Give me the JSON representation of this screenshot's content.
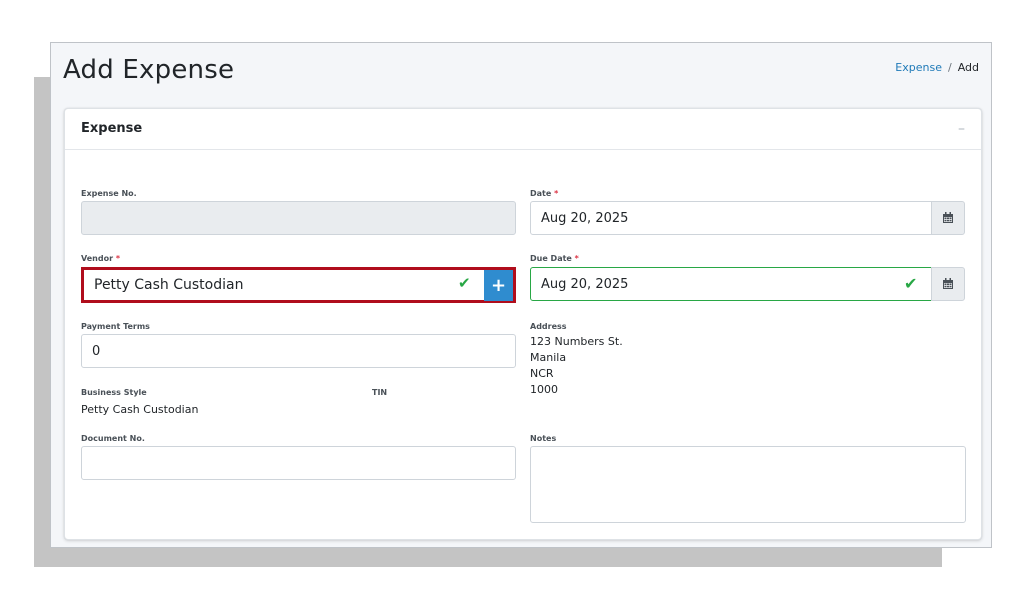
{
  "page": {
    "title": "Add Expense"
  },
  "breadcrumb": {
    "link": "Expense",
    "separator": "/",
    "current": "Add"
  },
  "card": {
    "title": "Expense",
    "collapse_icon": "minus-icon",
    "collapse_label": "–"
  },
  "form": {
    "expense_no": {
      "label": "Expense No.",
      "value": ""
    },
    "date": {
      "label": "Date",
      "required": "*",
      "value": "Aug 20, 2025",
      "icon": "calendar-icon"
    },
    "vendor": {
      "label": "Vendor",
      "required": "*",
      "value": "Petty Cash Custodian",
      "valid_icon": "check-icon",
      "add_label": "+"
    },
    "due_date": {
      "label": "Due Date",
      "required": "*",
      "value": "Aug 20, 2025",
      "valid_icon": "check-icon",
      "icon": "calendar-icon"
    },
    "payment_terms": {
      "label": "Payment Terms",
      "value": "0"
    },
    "address": {
      "label": "Address",
      "lines": [
        "123 Numbers St.",
        "Manila",
        "NCR",
        "1000"
      ]
    },
    "business_style": {
      "label": "Business Style",
      "value": "Petty Cash Custodian"
    },
    "tin": {
      "label": "TIN",
      "value": ""
    },
    "document_no": {
      "label": "Document No.",
      "value": ""
    },
    "notes": {
      "label": "Notes",
      "value": ""
    }
  },
  "colors": {
    "accent": "#2f8ccf",
    "valid": "#28a745",
    "highlight": "#b00d1c",
    "required": "#dc3545"
  }
}
